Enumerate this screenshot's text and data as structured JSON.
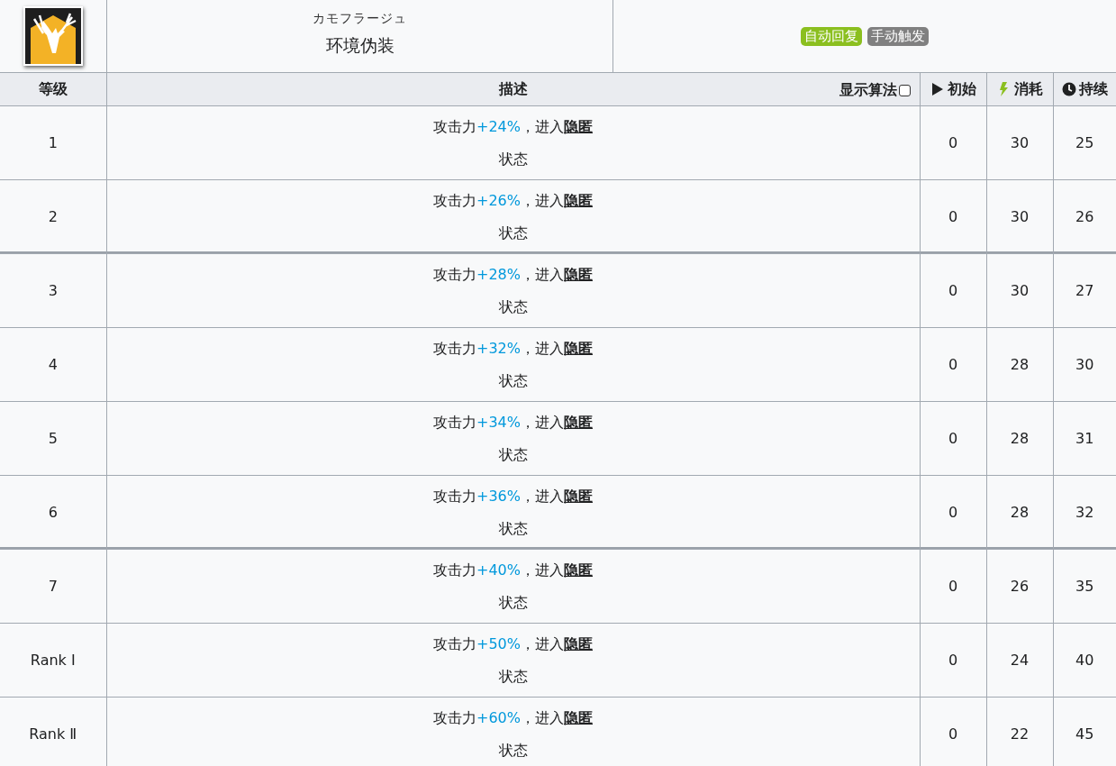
{
  "skill": {
    "name_ja": "カモフラージュ",
    "name": "环境伪装",
    "tags": [
      {
        "label": "自动回复",
        "color": "#8bbf1f"
      },
      {
        "label": "手动触发",
        "color": "#808080"
      }
    ]
  },
  "table": {
    "columns": [
      {
        "label": "等级",
        "kind": "text"
      },
      {
        "label": "描述",
        "kind": "desc"
      },
      {
        "label": "初始",
        "kind": "play"
      },
      {
        "label": "消耗",
        "kind": "bolt"
      },
      {
        "label": "持续",
        "kind": "clock"
      }
    ],
    "formula_toggle": {
      "label": "显示算法",
      "checked": false
    },
    "rows": [
      {
        "level": "1",
        "desc": {
          "text": "攻击力",
          "value": "+24%",
          "text2": "，进入",
          "link": "隐匿",
          "after": "状态"
        },
        "initial": "0",
        "cost": "30",
        "duration": "25",
        "divider_after": false
      },
      {
        "level": "2",
        "desc": {
          "text": "攻击力",
          "value": "+26%",
          "text2": "，进入",
          "link": "隐匿",
          "after": "状态"
        },
        "initial": "0",
        "cost": "30",
        "duration": "26",
        "divider_after": true
      },
      {
        "level": "3",
        "desc": {
          "text": "攻击力",
          "value": "+28%",
          "text2": "，进入",
          "link": "隐匿",
          "after": "状态"
        },
        "initial": "0",
        "cost": "30",
        "duration": "27",
        "divider_after": false
      },
      {
        "level": "4",
        "desc": {
          "text": "攻击力",
          "value": "+32%",
          "text2": "，进入",
          "link": "隐匿",
          "after": "状态"
        },
        "initial": "0",
        "cost": "28",
        "duration": "30",
        "divider_after": false
      },
      {
        "level": "5",
        "desc": {
          "text": "攻击力",
          "value": "+34%",
          "text2": "，进入",
          "link": "隐匿",
          "after": "状态"
        },
        "initial": "0",
        "cost": "28",
        "duration": "31",
        "divider_after": false
      },
      {
        "level": "6",
        "desc": {
          "text": "攻击力",
          "value": "+36%",
          "text2": "，进入",
          "link": "隐匿",
          "after": "状态"
        },
        "initial": "0",
        "cost": "28",
        "duration": "32",
        "divider_after": true
      },
      {
        "level": "7",
        "desc": {
          "text": "攻击力",
          "value": "+40%",
          "text2": "，进入",
          "link": "隐匿",
          "after": "状态"
        },
        "initial": "0",
        "cost": "26",
        "duration": "35",
        "divider_after": false
      },
      {
        "level": "Rank Ⅰ",
        "desc": {
          "text": "攻击力",
          "value": "+50%",
          "text2": "，进入",
          "link": "隐匿",
          "after": "状态"
        },
        "initial": "0",
        "cost": "24",
        "duration": "40",
        "divider_after": false
      },
      {
        "level": "Rank Ⅱ",
        "desc": {
          "text": "攻击力",
          "value": "+60%",
          "text2": "，进入",
          "link": "隐匿",
          "after": "状态"
        },
        "initial": "0",
        "cost": "22",
        "duration": "45"
      }
    ]
  }
}
